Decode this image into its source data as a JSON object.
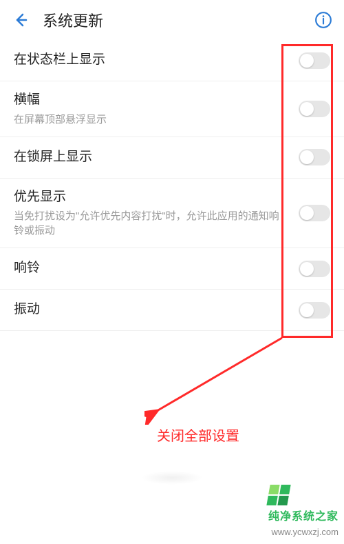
{
  "header": {
    "title": "系统更新"
  },
  "rows": [
    {
      "label": "在状态栏上显示",
      "sub": ""
    },
    {
      "label": "横幅",
      "sub": "在屏幕顶部悬浮显示"
    },
    {
      "label": "在锁屏上显示",
      "sub": ""
    },
    {
      "label": "优先显示",
      "sub": "当免打扰设为\"允许优先内容打扰\"时，允许此应用的通知响铃或振动"
    },
    {
      "label": "响铃",
      "sub": ""
    },
    {
      "label": "振动",
      "sub": ""
    }
  ],
  "annotation": {
    "text": "关闭全部设置"
  },
  "watermark": {
    "brand": "纯净系统之家",
    "url": "www.ycwxzj.com"
  }
}
